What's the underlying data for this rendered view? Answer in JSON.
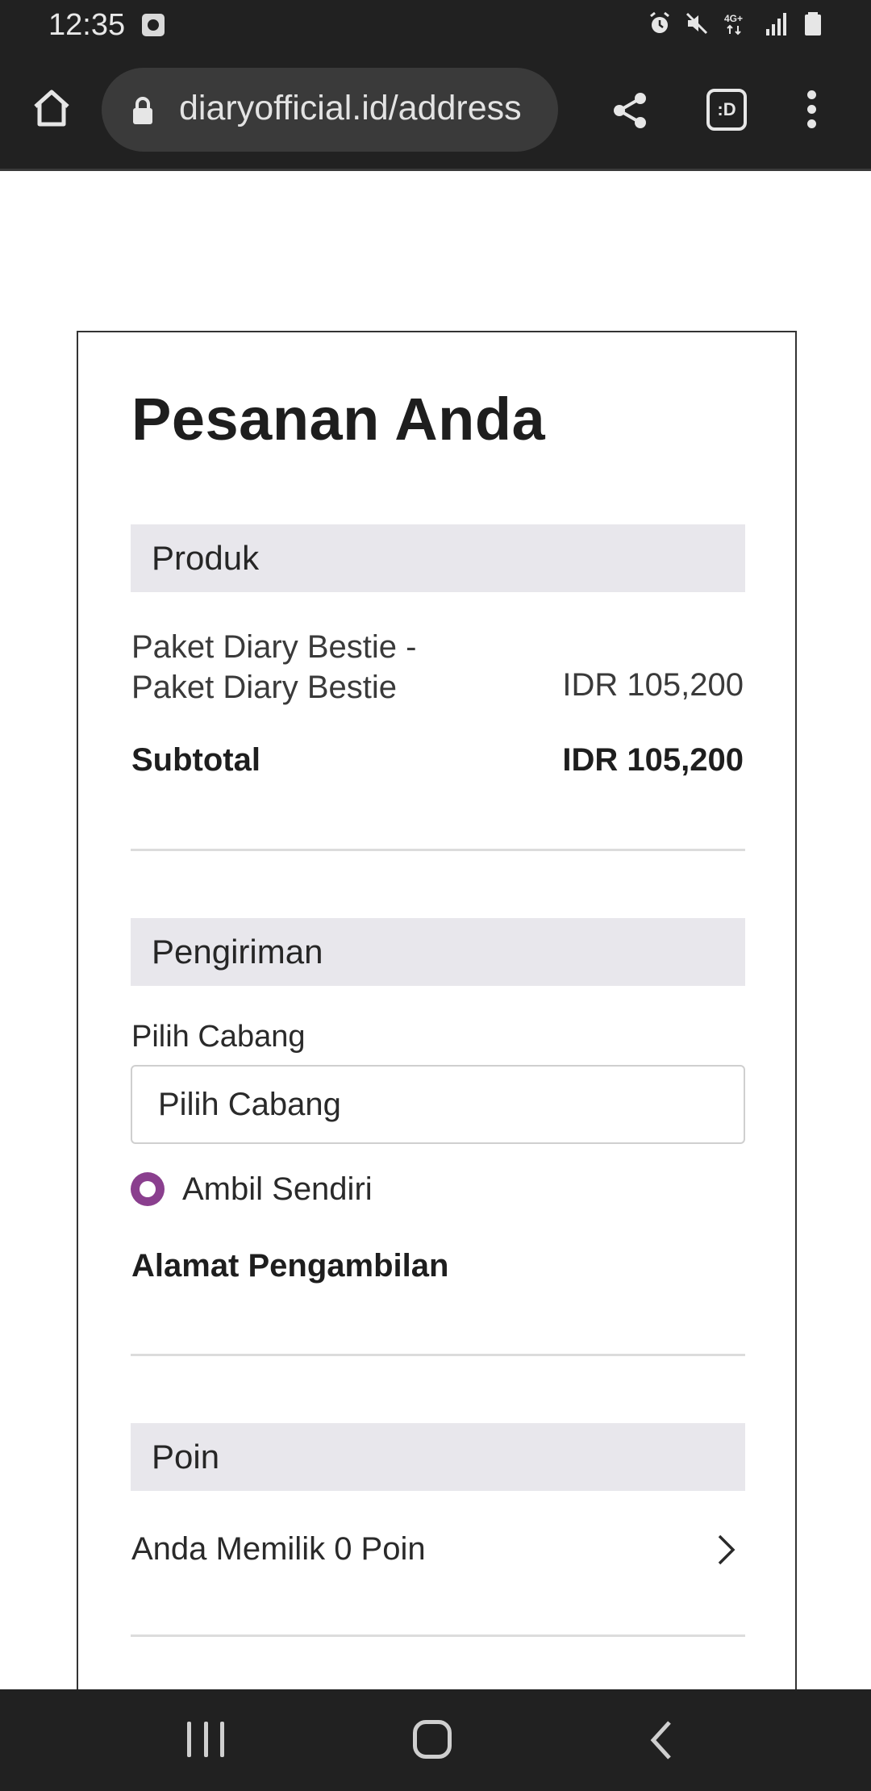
{
  "status_bar": {
    "time": "12:35",
    "icons": [
      "media-icon",
      "alarm-icon",
      "mute-icon",
      "4g-icon",
      "signal-icon",
      "battery-icon"
    ],
    "network_label": "4G+"
  },
  "browser": {
    "url": "diaryofficial.id/address",
    "tabs_label": ":D"
  },
  "order": {
    "title": "Pesanan Anda",
    "product_section": {
      "header": "Produk",
      "items": [
        {
          "name_line1": "Paket Diary Bestie -",
          "name_line2": "Paket Diary Bestie",
          "price": "IDR 105,200"
        }
      ],
      "subtotal_label": "Subtotal",
      "subtotal_value": "IDR 105,200"
    },
    "shipping_section": {
      "header": "Pengiriman",
      "branch_label": "Pilih Cabang",
      "branch_value": "Pilih Cabang",
      "pickup_option": "Ambil Sendiri",
      "pickup_selected": true,
      "pickup_address_heading": "Alamat Pengambilan"
    },
    "points_section": {
      "header": "Poin",
      "points_text": "Anda Memilik 0 Poin"
    }
  },
  "colors": {
    "accent": "#8a3f8e",
    "section_bg": "#e8e7ec",
    "chrome_bg": "#212121"
  }
}
